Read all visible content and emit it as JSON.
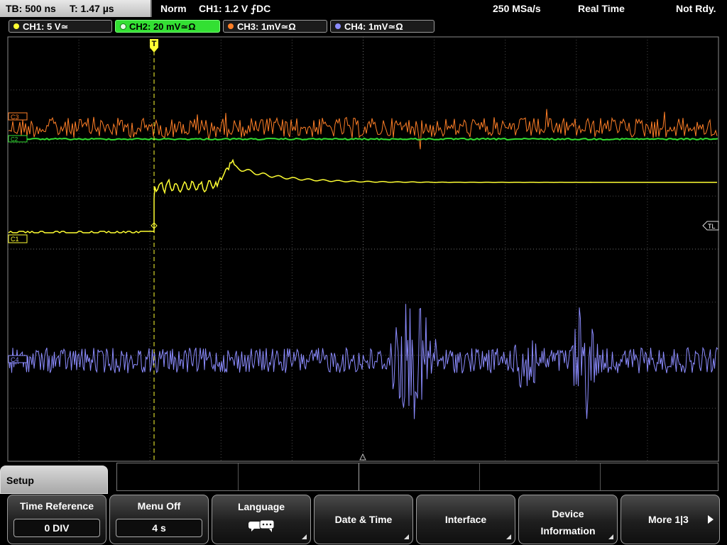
{
  "status": {
    "timebase": "TB: 500 ns",
    "trigger_time": "T: 1.47 µs",
    "trigger_mode": "Norm",
    "trigger_info": "CH1: 1.2 V ⨍DC",
    "sample_rate": "250 MSa/s",
    "acq_mode": "Real Time",
    "state": "Not Rdy."
  },
  "channels": [
    {
      "label": "CH1: 5 V≃",
      "color": "#ffff33"
    },
    {
      "label": "CH2: 20 mV≃Ω",
      "color": "#33e033",
      "active": true
    },
    {
      "label": "CH3: 1mV≃Ω",
      "color": "#ff7f27"
    },
    {
      "label": "CH4: 1mV≃Ω",
      "color": "#8c8cff"
    }
  ],
  "markers": {
    "c1": "C1",
    "c2": "C2",
    "c3": "C3",
    "c4": "C4",
    "trigger_level": "TL",
    "trigger_pos": "T"
  },
  "menu": {
    "title": "Setup",
    "buttons": [
      {
        "label": "Time Reference",
        "value": "0 DIV"
      },
      {
        "label": "Menu Off",
        "value": "4 s"
      },
      {
        "label": "Language",
        "icon": "speech-bubbles-icon"
      },
      {
        "label": "Date & Time"
      },
      {
        "label": "Interface"
      },
      {
        "label": "Device Information"
      },
      {
        "label": "More 1|3"
      }
    ]
  },
  "colors": {
    "grid": "#4a4a4a",
    "ch1": "#ffff33",
    "ch2": "#33e033",
    "ch3": "#ff7f27",
    "ch4": "#8c8cff"
  }
}
